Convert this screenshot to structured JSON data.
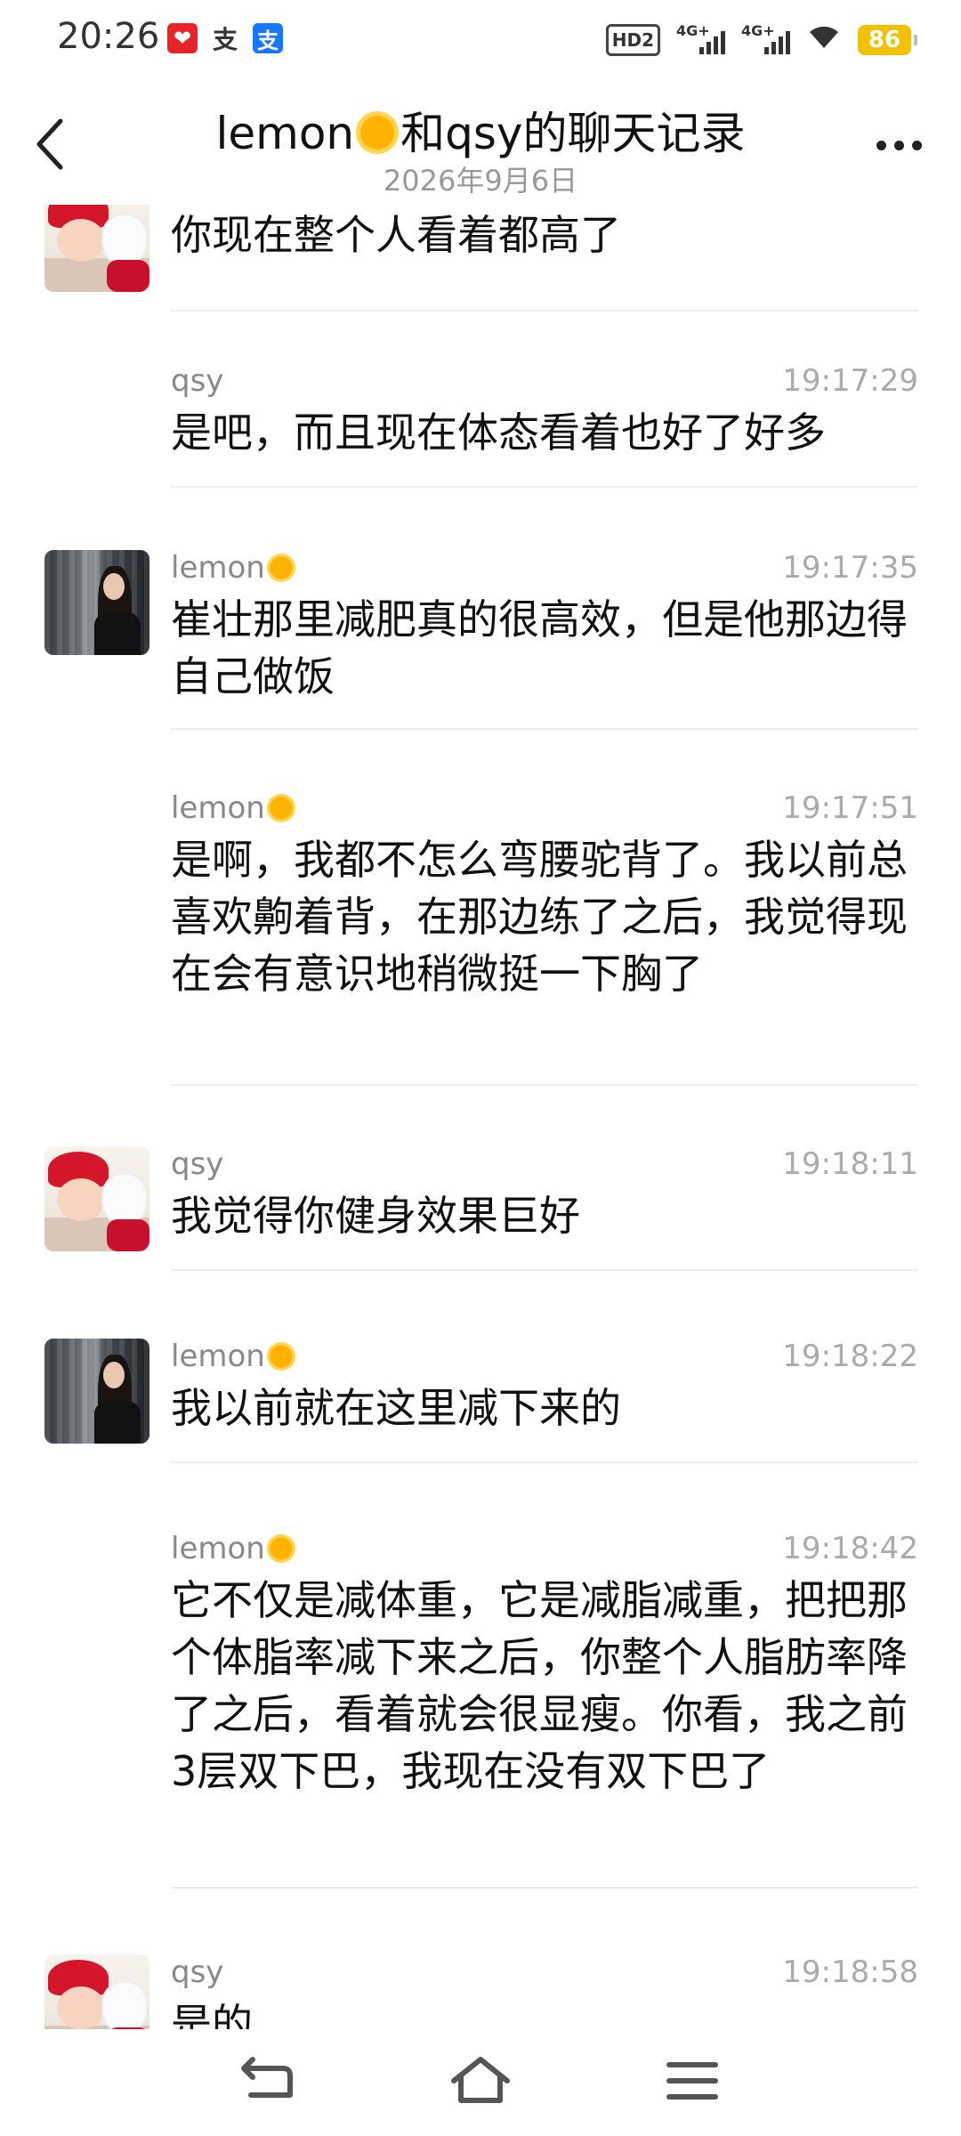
{
  "status_bar": {
    "time": "20:26",
    "icons_left": [
      "xiaohongshu-icon",
      "alipay-text-icon",
      "alipay-icon"
    ],
    "hd_label": "HD2",
    "signal1_label": "4G+",
    "signal2_label": "4G+",
    "battery": "86",
    "battery_color": "#f2c200"
  },
  "header": {
    "title_prefix": "lemon",
    "title_suffix": "和qsy的聊天记录",
    "date": "2026年9月6日"
  },
  "messages": [
    {
      "sender": "",
      "sun": false,
      "time": "",
      "text": "你现在整个人看着都高了",
      "avatar": "baby"
    },
    {
      "sender": "qsy",
      "sun": false,
      "time": "19:17:29",
      "text": "是吧，而且现在体态看着也好了好多",
      "avatar": ""
    },
    {
      "sender": "lemon",
      "sun": true,
      "time": "19:17:35",
      "text": "崔壮那里减肥真的很高效，但是他那边得自己做饭",
      "avatar": "girl"
    },
    {
      "sender": "lemon",
      "sun": true,
      "time": "19:17:51",
      "text": "是啊，我都不怎么弯腰驼背了。我以前总喜欢齁着背，在那边练了之后，我觉得现在会有意识地稍微挺一下胸了",
      "avatar": ""
    },
    {
      "sender": "qsy",
      "sun": false,
      "time": "19:18:11",
      "text": "我觉得你健身效果巨好",
      "avatar": "baby"
    },
    {
      "sender": "lemon",
      "sun": true,
      "time": "19:18:22",
      "text": "我以前就在这里减下来的",
      "avatar": "girl"
    },
    {
      "sender": "lemon",
      "sun": true,
      "time": "19:18:42",
      "text": "它不仅是减体重，它是减脂减重，把把那个体脂率减下来之后，你整个人脂肪率降了之后，看着就会很显瘦。你看，我之前3层双下巴，我现在没有双下巴了",
      "avatar": ""
    },
    {
      "sender": "qsy",
      "sun": false,
      "time": "19:18:58",
      "text": "是的",
      "avatar": "baby"
    }
  ],
  "nav": {
    "icons": [
      "back-nav-icon",
      "home-nav-icon",
      "menu-nav-icon"
    ]
  }
}
